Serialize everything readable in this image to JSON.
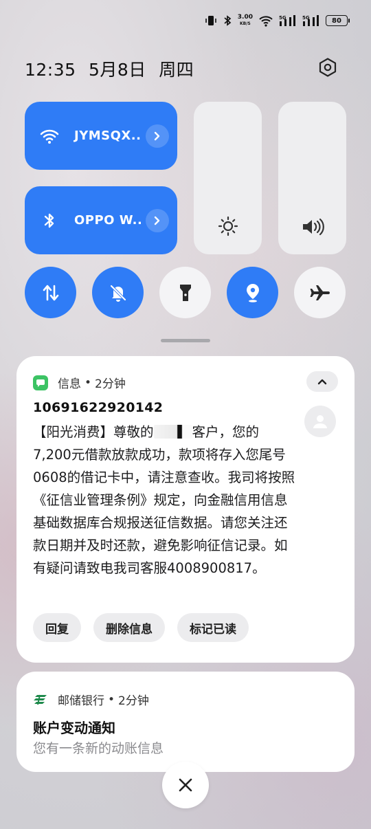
{
  "status_bar": {
    "net_speed": "3.00",
    "net_unit": "KB/S",
    "signal_1": "5G",
    "signal_2": "5G",
    "battery": "80",
    "icons": [
      "vibrate-icon",
      "bluetooth-icon",
      "wifi-icon",
      "signal-icon",
      "signal-icon",
      "battery-icon"
    ]
  },
  "header": {
    "time": "12:35",
    "date": "5月8日",
    "weekday": "周四",
    "settings_icon": "gear-icon"
  },
  "quick_settings": {
    "wifi": {
      "label": "JYMSQX..",
      "on": true
    },
    "bluetooth": {
      "label": "OPPO W..",
      "on": true
    },
    "brightness_icon": "sun-icon",
    "volume_icon": "speaker-icon",
    "toggles": [
      {
        "name": "mobile-data",
        "icon": "data-arrows-icon",
        "on": true
      },
      {
        "name": "mute",
        "icon": "bell-off-icon",
        "on": true
      },
      {
        "name": "flashlight",
        "icon": "flashlight-icon",
        "on": false
      },
      {
        "name": "location",
        "icon": "location-icon",
        "on": true
      },
      {
        "name": "airplane-mode",
        "icon": "airplane-icon",
        "on": false
      }
    ],
    "accent": "#2f7cf6"
  },
  "notifications": {
    "message": {
      "app": "信息",
      "time": "2分钟",
      "sender": "10691622920142",
      "body_pre": "【阳光消费】尊敬的",
      "body_post": "客户，您的7,200元借款放款成功，款项将存入您尾号0608的借记卡中，请注意查收。我司将按照《征信业管理条例》规定，向金融信用信息基础数据库合规报送征信数据。请您关注还款日期并及时还款，避免影响征信记录。如有疑问请致电我司客服4008900817。",
      "actions": [
        "回复",
        "删除信息",
        "标记已读"
      ],
      "app_color": "#3cc364"
    },
    "bank": {
      "app": "邮储银行",
      "time": "2分钟",
      "title": "账户变动通知",
      "subtitle": "您有一条新的动账信息",
      "app_color": "#1f8a4c"
    }
  },
  "separator": "•"
}
